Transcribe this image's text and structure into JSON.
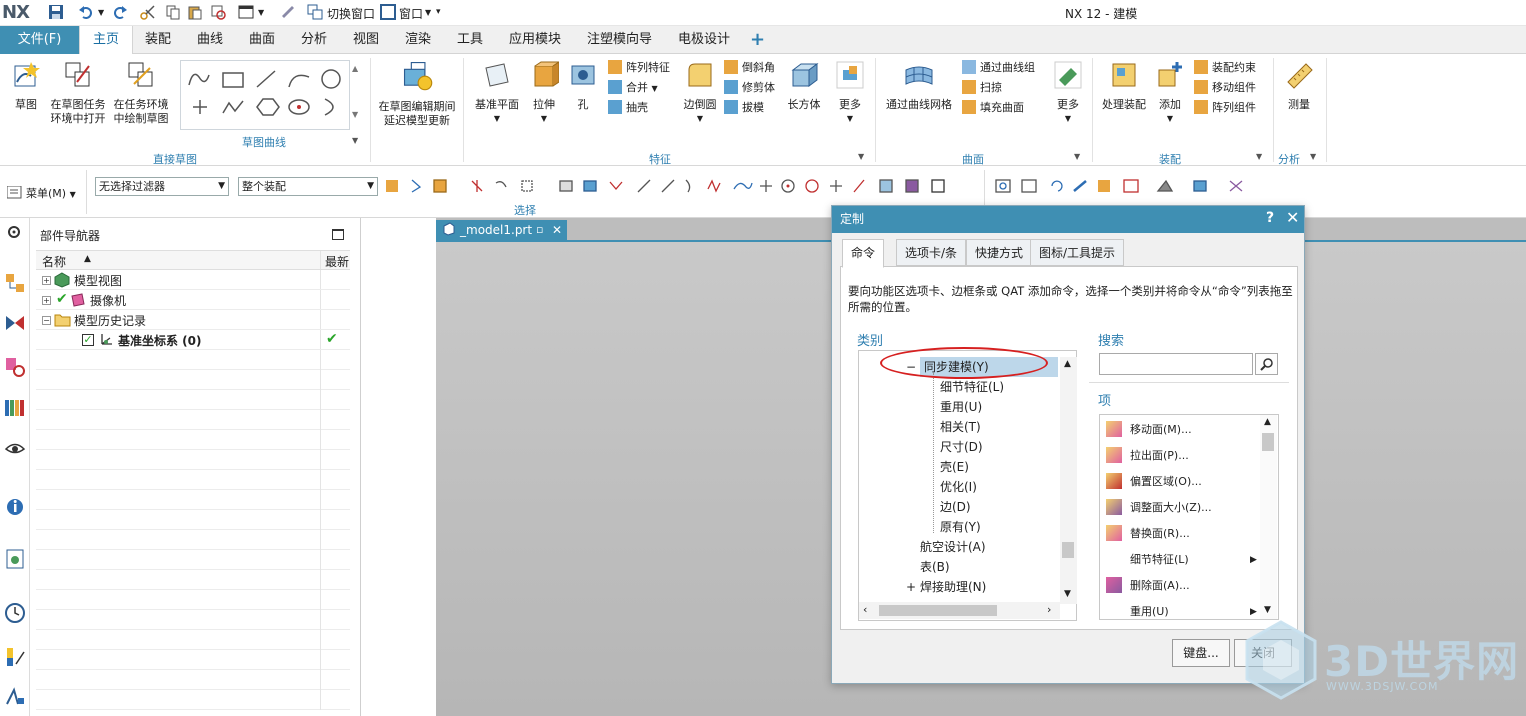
{
  "app": {
    "logo": "NX",
    "title": "NX 12 - 建模",
    "qat": {
      "switch_window": "切换窗口",
      "window": "窗口"
    }
  },
  "ribbon_tabs": [
    "文件(F)",
    "主页",
    "装配",
    "曲线",
    "曲面",
    "分析",
    "视图",
    "渲染",
    "工具",
    "应用模块",
    "注塑模向导",
    "电极设计"
  ],
  "ribbon": {
    "direct_sketch": {
      "label": "直接草图",
      "buttons": [
        "草图",
        "在草图任务\n环境中打开",
        "在任务环境\n中绘制草图"
      ]
    },
    "sketch_curve": {
      "label": "草图曲线"
    },
    "update": {
      "button": "在草图编辑期间\n延迟模型更新"
    },
    "feature": {
      "label": "特征",
      "big": [
        "基准平面",
        "拉伸",
        "孔"
      ],
      "small": [
        "阵列特征",
        "合并",
        "抽壳",
        "倒斜角",
        "修剪体",
        "拔模"
      ],
      "big2": [
        "边倒圆",
        "长方体",
        "更多"
      ]
    },
    "surface": {
      "label": "曲面",
      "big": "通过曲线网格",
      "small": [
        "通过曲线组",
        "扫掠",
        "填充曲面"
      ],
      "more": "更多"
    },
    "assembly": {
      "label": "装配",
      "big": [
        "处理装配",
        "添加"
      ],
      "small": [
        "装配约束",
        "移动组件",
        "阵列组件"
      ]
    },
    "analysis": {
      "label": "分析",
      "big": "测量"
    }
  },
  "selection_bar": {
    "menu": "菜单(M)",
    "filter": "无选择过滤器",
    "scope": "整个装配",
    "label": "选择"
  },
  "navigator": {
    "title": "部件导航器",
    "columns": [
      "名称",
      "最新"
    ],
    "rows": [
      {
        "label": "模型视图"
      },
      {
        "label": "摄像机"
      },
      {
        "label": "模型历史记录"
      },
      {
        "label": "基准坐标系 (0)"
      }
    ]
  },
  "graphics_tab": "_model1.prt",
  "dialog": {
    "title": "定制",
    "help": "?",
    "tabs": [
      "命令",
      "选项卡/条",
      "快捷方式",
      "图标/工具提示"
    ],
    "description": "要向功能区选项卡、边框条或 QAT 添加命令，选择一个类别并将命令从“命令”列表拖至所需的位置。",
    "category_label": "类别",
    "categories": [
      "同步建模(Y)",
      "细节特征(L)",
      "重用(U)",
      "相关(T)",
      "尺寸(D)",
      "壳(E)",
      "优化(I)",
      "边(D)",
      "原有(Y)",
      "航空设计(A)",
      "表(B)",
      "焊接助理(N)"
    ],
    "search_label": "搜索",
    "items_label": "项",
    "items": [
      "移动面(M)...",
      "拉出面(P)...",
      "偏置区域(O)...",
      "调整面大小(Z)...",
      "替换面(R)...",
      "细节特征(L)",
      "删除面(A)...",
      "重用(U)"
    ],
    "buttons": {
      "keyboard": "键盘...",
      "close": "关闭"
    }
  },
  "watermark": {
    "text": "3D世界网",
    "url": "WWW.3DSJW.COM"
  },
  "colors": {
    "accent": "#3f8fb3",
    "annotation": "#d62020",
    "check": "#2aa52a"
  }
}
